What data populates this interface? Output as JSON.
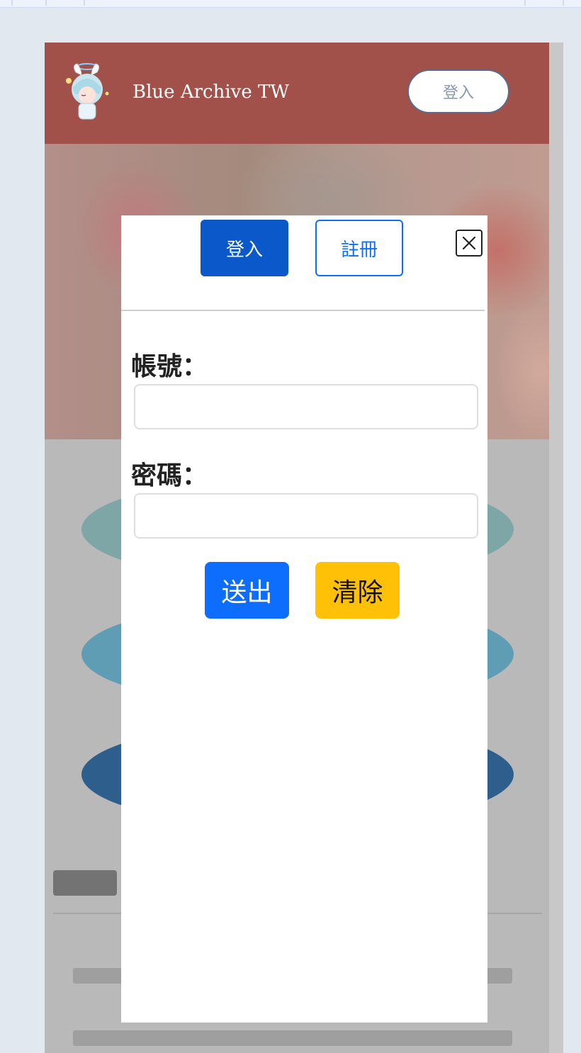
{
  "navbar": {
    "brand": "Blue Archive TW",
    "login_button": "登入",
    "logo_icon": "chibi-character-logo",
    "background": "#a2514a"
  },
  "modal": {
    "tabs": [
      {
        "label": "登入",
        "active": true
      },
      {
        "label": "註冊",
        "active": false
      }
    ],
    "close_icon": "close-x-icon",
    "fields": {
      "account_label": "帳號：",
      "account_value": "",
      "password_label": "密碼：",
      "password_value": ""
    },
    "actions": {
      "submit_label": "送出",
      "clear_label": "清除"
    },
    "colors": {
      "primary": "#0d6efd",
      "active_tab": "#0a58ca",
      "warning": "#ffc107"
    }
  }
}
